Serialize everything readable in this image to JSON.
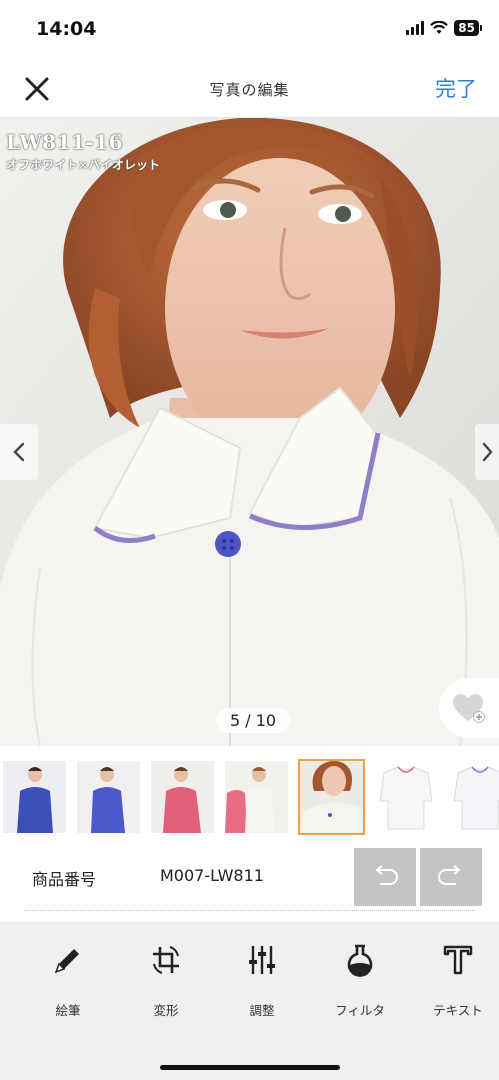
{
  "status_bar": {
    "time": "14:04",
    "battery": "85"
  },
  "header": {
    "title": "写真の編集",
    "done_label": "完了"
  },
  "photo": {
    "code": "LW811-16",
    "color_name": "オフホワイト×バイオレット",
    "page_indicator": "5 / 10",
    "current_page": 5,
    "total_pages": 10
  },
  "thumbnails": [
    {
      "name": "thumb-1",
      "color": "#3d4fb8"
    },
    {
      "name": "thumb-2",
      "color": "#4b5ac8"
    },
    {
      "name": "thumb-3",
      "color": "#e0607a"
    },
    {
      "name": "thumb-4",
      "color": "#e86c84"
    },
    {
      "name": "thumb-5",
      "color": "#f4f3ee",
      "selected": true
    },
    {
      "name": "thumb-6",
      "color": "#ffffff"
    },
    {
      "name": "thumb-7",
      "color": "#f6f6f8"
    }
  ],
  "product": {
    "label": "商品番号",
    "value": "M007-LW811"
  },
  "tools": [
    {
      "icon": "pencil-icon",
      "label": "絵筆"
    },
    {
      "icon": "crop-rotate-icon",
      "label": "変形"
    },
    {
      "icon": "sliders-icon",
      "label": "調整"
    },
    {
      "icon": "filter-flask-icon",
      "label": "フィルタ"
    },
    {
      "icon": "text-icon",
      "label": "テキスト"
    }
  ],
  "colors": {
    "accent": "#2f7ee0",
    "selected_thumb": "#f0a040",
    "toolbar_bg": "#f0f0f0"
  }
}
